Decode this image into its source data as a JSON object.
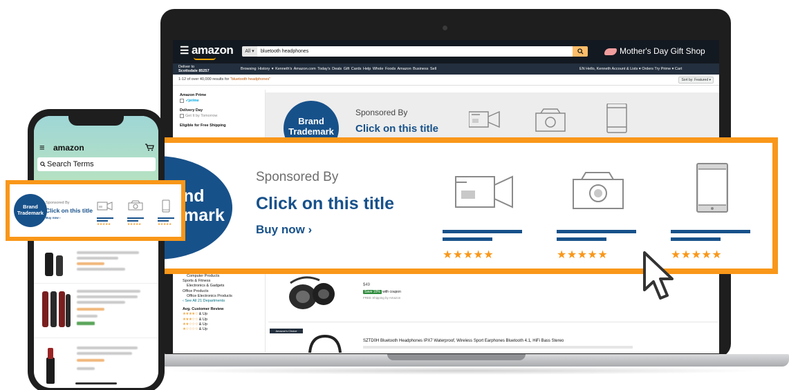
{
  "laptop": {
    "logo": "amazon",
    "search_category": "All",
    "search_query": "bluetooth headphones",
    "promo": "Mother's Day Gift Shop",
    "deliver_line1": "Deliver to",
    "deliver_line2": "Scottsdale 85257",
    "nav_links": "Browsing History ▾   Kenneth's Amazon.com   Today's Deals   Gift Cards   Help   Whole Foods   Amazon Business   Sell",
    "nav_right": "EN   Hello, Kenneth   Account & Lists ▾   Orders   Try Prime ▾   Cart",
    "results_prefix": "1-12 of over 40,000 results for",
    "results_query": "\"bluetooth headphones\"",
    "sort_label": "Sort by: Featured ▾",
    "sidebar": {
      "prime_heading": "Amazon Prime",
      "prime_logo": "✓prime",
      "delivery_heading": "Delivery Day",
      "delivery_option": "Get It by Tomorrow",
      "shipping_heading": "Eligible for Free Shipping",
      "computer_products": "Computer Products",
      "sports": "Sports & Fitness",
      "electronics": "Electronics & Gadgets",
      "office": "Office Products",
      "office_elec": "Office Electronics Products",
      "see_all": "‹ See All 21 Departments",
      "review_heading": "Avg. Customer Review",
      "and_up": "& Up",
      "stars": [
        "★★★★☆",
        "★★★☆☆",
        "★★☆☆☆",
        "★☆☆☆☆"
      ]
    },
    "bg_banner": {
      "logo_line1": "Brand",
      "logo_line2": "Trademark",
      "sponsored": "Sponsored By",
      "title": "Click on this title"
    },
    "product1": {
      "price": "$49",
      "deal": "Save 10%",
      "deal_suffix": "with coupon",
      "shipping": "FREE Shipping by Amazon"
    },
    "product2": {
      "badge": "Amazon's Choice",
      "title": "SZTD0H Bluetooth Headphones IPX7 Waterproof, Wireless Sport Earphones Bluetooth 4.1, HiFi Bass Stereo"
    }
  },
  "callout": {
    "logo_line1": "nd",
    "logo_line2": "mark",
    "sponsored": "Sponsored By",
    "title": "Click on this title",
    "buy_now": "Buy now ›",
    "products": [
      {
        "icon": "video-camera-icon",
        "rating": "★★★★★"
      },
      {
        "icon": "camera-icon",
        "rating": "★★★★★"
      },
      {
        "icon": "tablet-icon",
        "rating": "★★★★★"
      }
    ]
  },
  "phone": {
    "logo": "amazon",
    "search_placeholder": "Search Terms",
    "mini": {
      "logo_line1": "Brand",
      "logo_line2": "Trademark",
      "sponsored": "Sponsored By",
      "title": "Click on this title",
      "buy_now": "Buy now ›",
      "rating": "★★★★★"
    }
  },
  "colors": {
    "highlight": "#f99719",
    "brand_blue": "#17518a",
    "amazon_dark": "#131921"
  }
}
